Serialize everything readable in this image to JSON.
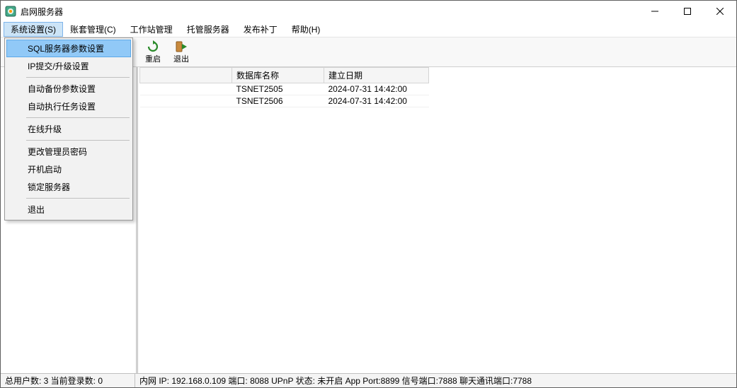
{
  "window": {
    "title": "启网服务器"
  },
  "menubar": [
    "系统设置(S)",
    "账套管理(C)",
    "工作站管理",
    "托管服务器",
    "发布补丁",
    "帮助(H)"
  ],
  "toolbar": {
    "restart": "重启",
    "exit": "退出"
  },
  "dropdown": {
    "items": [
      {
        "label": "SQL服务器参数设置",
        "highlight": true
      },
      {
        "label": "IP提交/升级设置"
      },
      {
        "sep": true
      },
      {
        "label": "自动备份参数设置"
      },
      {
        "label": "自动执行任务设置"
      },
      {
        "sep": true
      },
      {
        "label": "在线升级"
      },
      {
        "sep": true
      },
      {
        "label": "更改管理员密码"
      },
      {
        "label": "开机启动"
      },
      {
        "label": "锁定服务器"
      },
      {
        "sep": true
      },
      {
        "label": "退出"
      }
    ]
  },
  "table": {
    "headers": {
      "col1": "",
      "col2": "数据库名称",
      "col3": "建立日期"
    },
    "rows": [
      {
        "c1": "",
        "c2": "TSNET2505",
        "c3": "2024-07-31 14:42:00"
      },
      {
        "c1": "",
        "c2": "TSNET2506",
        "c3": "2024-07-31 14:42:00"
      }
    ]
  },
  "status": {
    "left": "总用户数:  3  当前登录数:  0",
    "right": "内网 IP: 192.168.0.109 端口: 8088 UPnP 状态: 未开启 App Port:8899 信号端口:7888 聊天通讯端口:7788"
  }
}
